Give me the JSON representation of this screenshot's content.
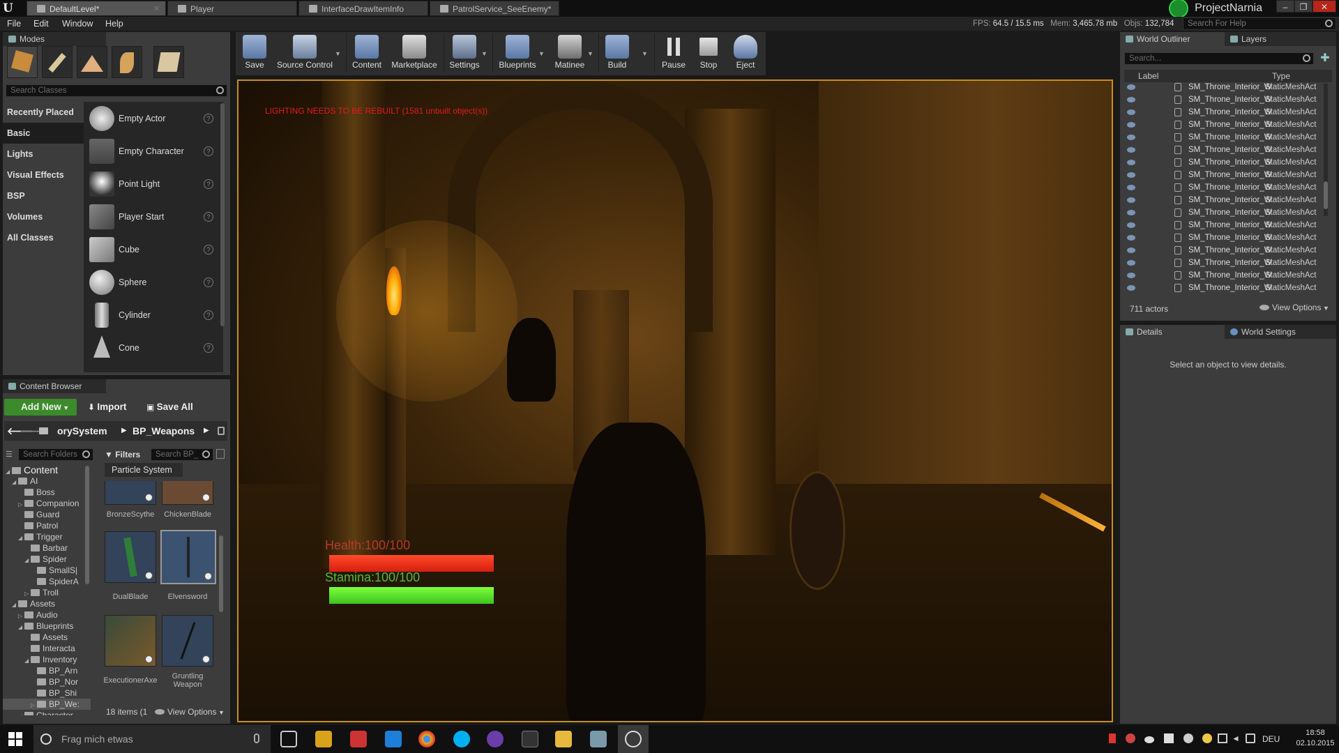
{
  "titlebar": {
    "tabs": [
      "DefaultLevel*",
      "Player",
      "InterfaceDrawItemInfo",
      "PatrolService_SeeEnemy*"
    ],
    "project_name": "ProjectNarnia",
    "min": "–",
    "max": "❐",
    "close": "✕"
  },
  "menu": {
    "items": [
      "File",
      "Edit",
      "Window",
      "Help"
    ]
  },
  "stats": {
    "fps_label": "FPS:",
    "fps": "64.5",
    "ms": "/ 15.5 ms",
    "mem_label": "Mem:",
    "mem": "3,465.78 mb",
    "objs_label": "Objs:",
    "objs": "132,784"
  },
  "help_search": {
    "placeholder": "Search For Help"
  },
  "modes": {
    "title": "Modes",
    "search_placeholder": "Search Classes",
    "categories": [
      "Recently Placed",
      "Basic",
      "Lights",
      "Visual Effects",
      "BSP",
      "Volumes",
      "All Classes"
    ],
    "items": [
      "Empty Actor",
      "Empty Character",
      "Point Light",
      "Player Start",
      "Cube",
      "Sphere",
      "Cylinder",
      "Cone"
    ],
    "help_glyph": "?"
  },
  "toolbar": {
    "buttons": [
      "Save",
      "Source Control",
      "Content",
      "Marketplace",
      "Settings",
      "Blueprints",
      "Matinee",
      "Build",
      "Pause",
      "Stop",
      "Eject"
    ]
  },
  "viewport": {
    "lighting_warning": "LIGHTING NEEDS TO BE REBUILT (1581 unbuilt object(s))",
    "health_label": "Health:100/100",
    "health_fraction": 1.0,
    "stamina_label": "Stamina:100/100",
    "stamina_fraction": 1.0
  },
  "outliner": {
    "tab_world": "World Outliner",
    "tab_layers": "Layers",
    "search_placeholder": "Search...",
    "col_label": "Label",
    "col_type": "Type",
    "row_label": "SM_Throne_Interior_W",
    "row_type": "StaticMeshAct",
    "actor_count": "711 actors",
    "view_options": "View Options"
  },
  "details": {
    "tab_details": "Details",
    "tab_world_settings": "World Settings",
    "empty_text": "Select an object to view details."
  },
  "content_browser": {
    "title": "Content Browser",
    "add_new": "Add New",
    "import": "Import",
    "save_all": "Save All",
    "path": [
      "orySystem",
      "BP_Weapons"
    ],
    "search_folders": "Search Folders",
    "filters": "Filters",
    "search_assets": "Search BP_",
    "filter_chip": "Particle System",
    "tree": [
      {
        "label": "Content",
        "indent": 0,
        "arrow": "◢"
      },
      {
        "label": "AI",
        "indent": 1,
        "arrow": "◢"
      },
      {
        "label": "Boss",
        "indent": 2,
        "arrow": ""
      },
      {
        "label": "Companion",
        "indent": 2,
        "arrow": "▷"
      },
      {
        "label": "Guard",
        "indent": 2,
        "arrow": ""
      },
      {
        "label": "Patrol",
        "indent": 2,
        "arrow": ""
      },
      {
        "label": "Trigger",
        "indent": 2,
        "arrow": "◢"
      },
      {
        "label": "Barbar",
        "indent": 3,
        "arrow": ""
      },
      {
        "label": "Spider",
        "indent": 3,
        "arrow": "◢"
      },
      {
        "label": "SmallS|",
        "indent": 4,
        "arrow": ""
      },
      {
        "label": "SpiderA",
        "indent": 4,
        "arrow": ""
      },
      {
        "label": "Troll",
        "indent": 3,
        "arrow": "▷"
      },
      {
        "label": "Assets",
        "indent": 1,
        "arrow": "◢"
      },
      {
        "label": "Audio",
        "indent": 2,
        "arrow": "▷"
      },
      {
        "label": "Blueprints",
        "indent": 2,
        "arrow": "◢"
      },
      {
        "label": "Assets",
        "indent": 3,
        "arrow": ""
      },
      {
        "label": "Interacta",
        "indent": 3,
        "arrow": ""
      },
      {
        "label": "Inventory",
        "indent": 3,
        "arrow": "◢"
      },
      {
        "label": "BP_Arn",
        "indent": 4,
        "arrow": ""
      },
      {
        "label": "BP_Nor",
        "indent": 4,
        "arrow": ""
      },
      {
        "label": "BP_Shi",
        "indent": 4,
        "arrow": ""
      },
      {
        "label": "BP_We:",
        "indent": 4,
        "arrow": "▷"
      },
      {
        "label": "Character",
        "indent": 2,
        "arrow": "◢"
      }
    ],
    "assets": [
      "BronzeScythe",
      "ChickenBlade",
      "DualBlade",
      "Elvensword",
      "ExecutionerAxe",
      "Gruntling Weapon"
    ],
    "item_count": "18 items (1",
    "view_options": "View Options"
  },
  "taskbar": {
    "search_text": "Frag mich etwas",
    "language": "DEU",
    "time": "18:58",
    "date": "02.10.2015"
  }
}
